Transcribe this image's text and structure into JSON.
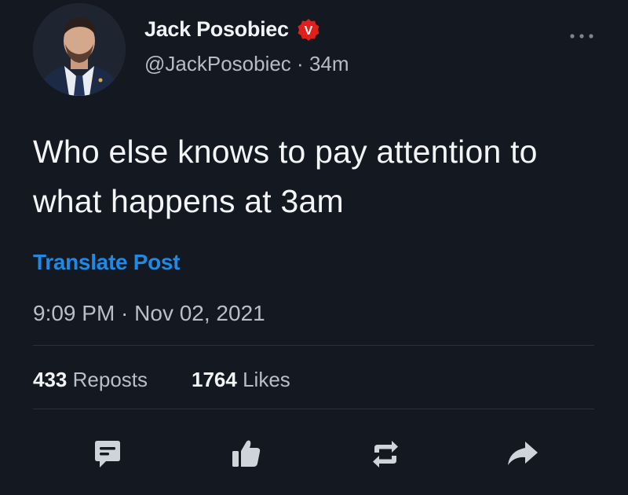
{
  "author": {
    "display_name": "Jack Posobiec",
    "handle": "@JackPosobiec",
    "relative_time": "34m",
    "separator": "·",
    "badge_letter": "V",
    "badge_color": "#e0201b"
  },
  "post": {
    "text": "Who else knows to pay attention to what happens at 3am",
    "translate_label": "Translate Post",
    "timestamp": "9:09 PM · Nov 02, 2021"
  },
  "stats": {
    "reposts_count": "433",
    "reposts_label": "Reposts",
    "likes_count": "1764",
    "likes_label": "Likes"
  },
  "actions": [
    "comment-icon",
    "like-icon",
    "repost-icon",
    "share-icon"
  ],
  "colors": {
    "background": "#141821",
    "link": "#1d8ae6",
    "muted_text": "#b9bec7",
    "icon": "#cfd3da"
  }
}
